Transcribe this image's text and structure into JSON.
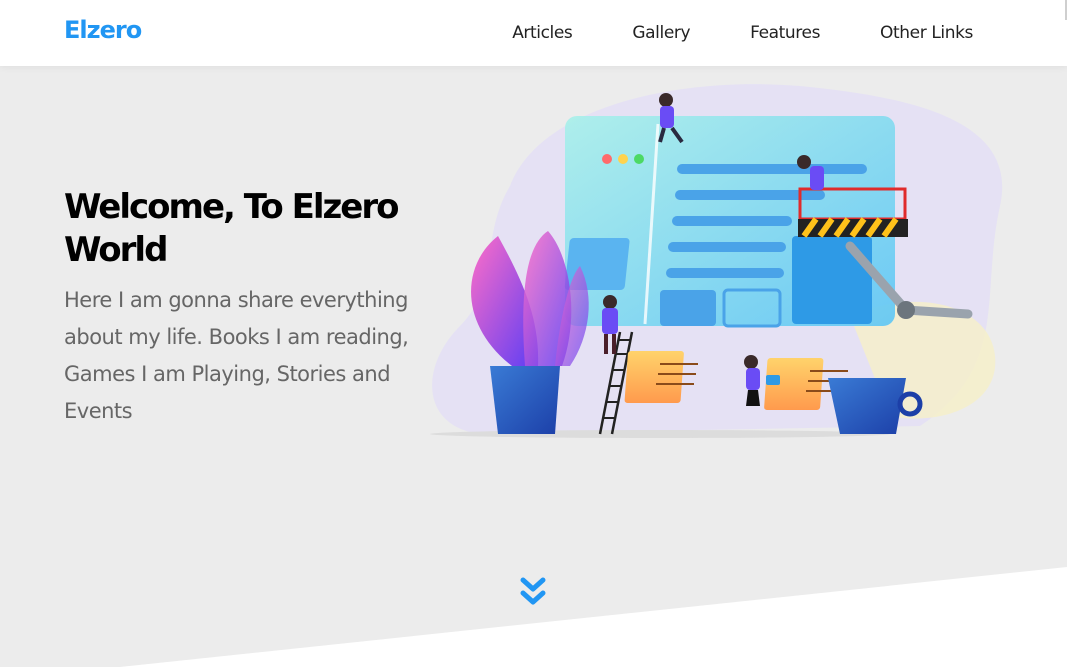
{
  "header": {
    "logo": "Elzero",
    "nav": [
      {
        "label": "Articles"
      },
      {
        "label": "Gallery"
      },
      {
        "label": "Features"
      },
      {
        "label": "Other Links"
      }
    ]
  },
  "landing": {
    "title": "Welcome, To Elzero World",
    "description": "Here I am gonna share everything about my life. Books I am reading, Games I am Playing, Stories and Events",
    "illustration": "website-building-team-illustration",
    "scroll_icon": "double-chevron-down-icon"
  },
  "colors": {
    "accent": "#2196f3",
    "landing_bg": "#ececec",
    "text": "#000000",
    "muted_text": "#666666"
  }
}
